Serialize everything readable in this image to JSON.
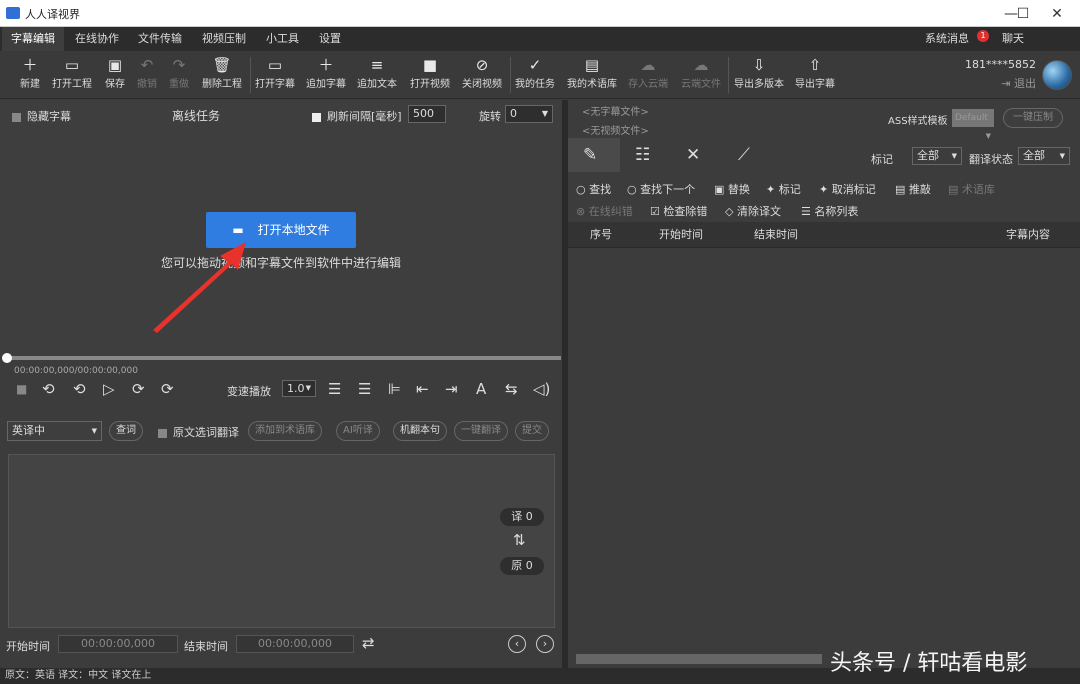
{
  "app": {
    "title": "人人译视界"
  },
  "window": {
    "minimize": "—",
    "maximize": "☐",
    "close": "✕"
  },
  "menu": [
    "字幕编辑",
    "在线协作",
    "文件传输",
    "视频压制",
    "小工具",
    "设置"
  ],
  "notify": {
    "label": "系统消息",
    "badge": "1",
    "chat": "聊天"
  },
  "toolbar": [
    {
      "label": "新建",
      "icon": "＋"
    },
    {
      "label": "打开工程",
      "icon": "▭"
    },
    {
      "label": "保存",
      "icon": "▣"
    },
    {
      "label": "撤销",
      "icon": "↶"
    },
    {
      "label": "重做",
      "icon": "↷"
    },
    {
      "label": "删除工程",
      "icon": "🗑"
    },
    {
      "label": "打开字幕",
      "icon": "▭"
    },
    {
      "label": "追加字幕",
      "icon": "＋"
    },
    {
      "label": "追加文本",
      "icon": "≡"
    },
    {
      "label": "打开视频",
      "icon": "■"
    },
    {
      "label": "关闭视频",
      "icon": "⊘"
    },
    {
      "label": "我的任务",
      "icon": "✓"
    },
    {
      "label": "我的术语库",
      "icon": "▤"
    },
    {
      "label": "存入云端",
      "icon": "☁"
    },
    {
      "label": "云端文件",
      "icon": "☁"
    },
    {
      "label": "导出多版本",
      "icon": "⇩"
    },
    {
      "label": "导出字幕",
      "icon": "⇧"
    }
  ],
  "user": {
    "id": "181****5852",
    "logout": "退出"
  },
  "left": {
    "hide_subtitle": "隐藏字幕",
    "offline": "离线任务",
    "refresh_label": "刷新间隔[毫秒]",
    "refresh_value": "500",
    "rotate_label": "旋转",
    "rotate_value": "0",
    "open_button": "打开本地文件",
    "drop_hint": "您可以拖动视频和字幕文件到软件中进行编辑"
  },
  "player": {
    "time": "00:00:00,000/00:00:00,000",
    "speed_label": "变速播放",
    "speed_value": "1.0"
  },
  "translate": {
    "lang": "英译中",
    "lookup": "查词",
    "select_translate": "原文选词翻译",
    "add_term": "添加到术语库",
    "ai_listen": "AI听译",
    "machine": "机翻本句",
    "one_click": "一键翻译",
    "submit": "提交",
    "trans_count": "译 0",
    "orig_count": "原 0"
  },
  "timing": {
    "start_label": "开始时间",
    "start_value": "00:00:00,000",
    "end_label": "结束时间",
    "end_value": "00:00:00,000"
  },
  "right": {
    "no_sub": "<无字幕文件>",
    "no_video": "<无视频文件>",
    "ass_label": "ASS样式模板",
    "ass_value": "Default",
    "compress": "一键压制",
    "mark_label": "标记",
    "mark_value": "全部",
    "tstate_label": "翻译状态",
    "tstate_value": "全部",
    "tools1": [
      "查找",
      "查找下一个",
      "替换",
      "标记",
      "取消标记",
      "推敲",
      "术语库"
    ],
    "tools2": [
      "在线纠错",
      "检查除错",
      "清除译文",
      "名称列表"
    ],
    "headers": [
      "序号",
      "开始时间",
      "结束时间",
      "字幕内容"
    ]
  },
  "status": "原文：英语  译文：中文    译文在上",
  "watermark": "头条号 / 轩咕看电影"
}
